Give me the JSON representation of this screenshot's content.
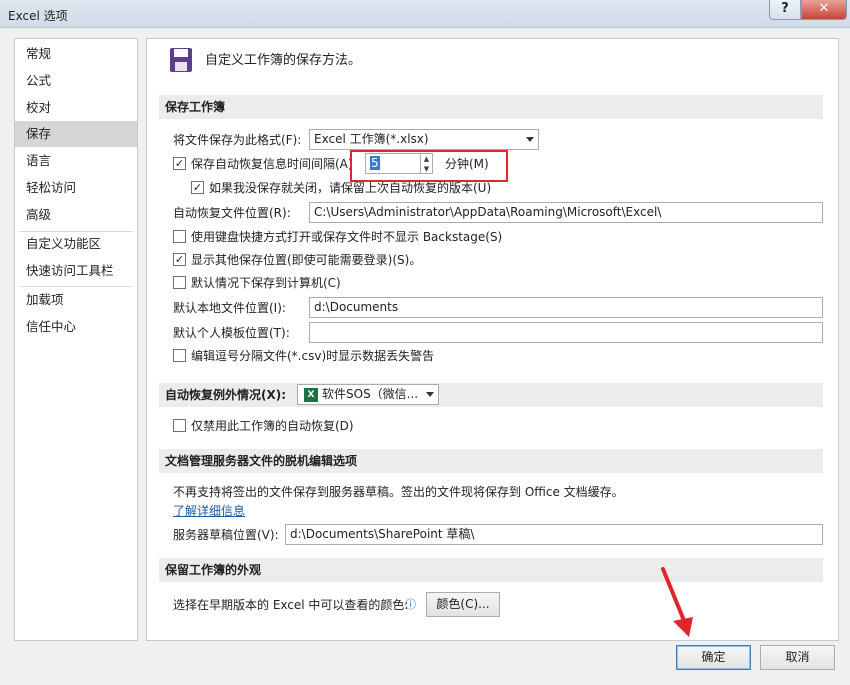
{
  "window": {
    "title": "Excel 选项",
    "help_label": "?",
    "close_label": "✕"
  },
  "nav": [
    {
      "label": "常规"
    },
    {
      "label": "公式"
    },
    {
      "label": "校对"
    },
    {
      "label": "保存"
    },
    {
      "label": "语言"
    },
    {
      "label": "轻松访问"
    },
    {
      "label": "高级"
    },
    {
      "label": "自定义功能区"
    },
    {
      "label": "快速访问工具栏"
    },
    {
      "label": "加载项"
    },
    {
      "label": "信任中心"
    }
  ],
  "header": {
    "text": "自定义工作簿的保存方法。",
    "icon": "floppy-disk-icon"
  },
  "save_section": {
    "title": "保存工作簿",
    "format_label": "将文件保存为此格式(F):",
    "format_value": "Excel 工作簿(*.xlsx)",
    "autorecover_label": "保存自动恢复信息时间间隔(A)",
    "autorecover_checked": true,
    "minutes_value": "5",
    "minutes_label": "分钟(M)",
    "keep_last_label": "如果我没保存就关闭，请保留上次自动恢复的版本(U)",
    "keep_last_checked": true,
    "autorecover_loc_label": "自动恢复文件位置(R):",
    "autorecover_loc_value": "C:\\Users\\Administrator\\AppData\\Roaming\\Microsoft\\Excel\\",
    "backstage_label": "使用键盘快捷方式打开或保存文件时不显示 Backstage(S)",
    "backstage_checked": false,
    "other_loc_label": "显示其他保存位置(即使可能需要登录)(S)。",
    "other_loc_checked": true,
    "save_to_pc_label": "默认情况下保存到计算机(C)",
    "save_to_pc_checked": false,
    "local_loc_label": "默认本地文件位置(I):",
    "local_loc_value": "d:\\Documents",
    "template_loc_label": "默认个人模板位置(T):",
    "template_loc_value": "",
    "csv_warn_label": "编辑逗号分隔文件(*.csv)时显示数据丢失警告",
    "csv_warn_checked": false
  },
  "exceptions_section": {
    "title": "自动恢复例外情况(X):",
    "workbook_value": "软件SOS（微信...",
    "disable_label": "仅禁用此工作簿的自动恢复(D)",
    "disable_checked": false
  },
  "offline_section": {
    "title": "文档管理服务器文件的脱机编辑选项",
    "notice": "不再支持将签出的文件保存到服务器草稿。签出的文件现将保存到 Office 文档缓存。",
    "learn_more": "了解详细信息",
    "drafts_label": "服务器草稿位置(V):",
    "drafts_value": "d:\\Documents\\SharePoint 草稿\\"
  },
  "appearance_section": {
    "title": "保留工作簿的外观",
    "colors_label": "选择在早期版本的 Excel 中可以查看的颜色:",
    "colors_button": "颜色(C)..."
  },
  "footer": {
    "ok_label": "确定",
    "cancel_label": "取消"
  },
  "colors": {
    "highlight": "#e0262b",
    "nav_active": "#d6d6d6",
    "excel_green": "#1e7145"
  }
}
